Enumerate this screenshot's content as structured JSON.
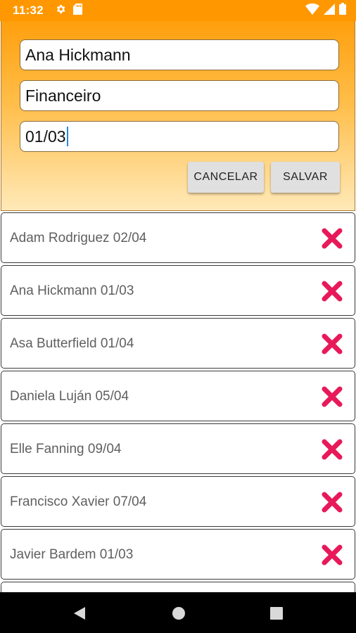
{
  "status_bar": {
    "time": "11:32",
    "icons": [
      "gear-icon",
      "sd-card-icon",
      "wifi-icon",
      "signal-icon",
      "battery-icon"
    ]
  },
  "form": {
    "name_value": "Ana Hickmann",
    "department_value": "Financeiro",
    "date_value": "01/03",
    "cancel_label": "CANCELAR",
    "save_label": "SALVAR"
  },
  "list": {
    "items": [
      {
        "text": "Adam Rodriguez 02/04"
      },
      {
        "text": "Ana Hickmann 01/03"
      },
      {
        "text": "Asa Butterfield 01/04"
      },
      {
        "text": "Daniela Luján 05/04"
      },
      {
        "text": "Elle Fanning 09/04"
      },
      {
        "text": "Francisco Xavier 07/04"
      },
      {
        "text": "Javier Bardem 01/03"
      },
      {
        "text": ""
      }
    ]
  },
  "colors": {
    "status_bar": "#ff9800",
    "form_gradient_top": "#ff9f0d",
    "form_gradient_bottom": "#ffe9b8",
    "delete_icon": "#e8195a",
    "cursor": "#1e88e5"
  },
  "nav_bar": {
    "icons": [
      "back-icon",
      "home-icon",
      "recents-icon"
    ]
  }
}
